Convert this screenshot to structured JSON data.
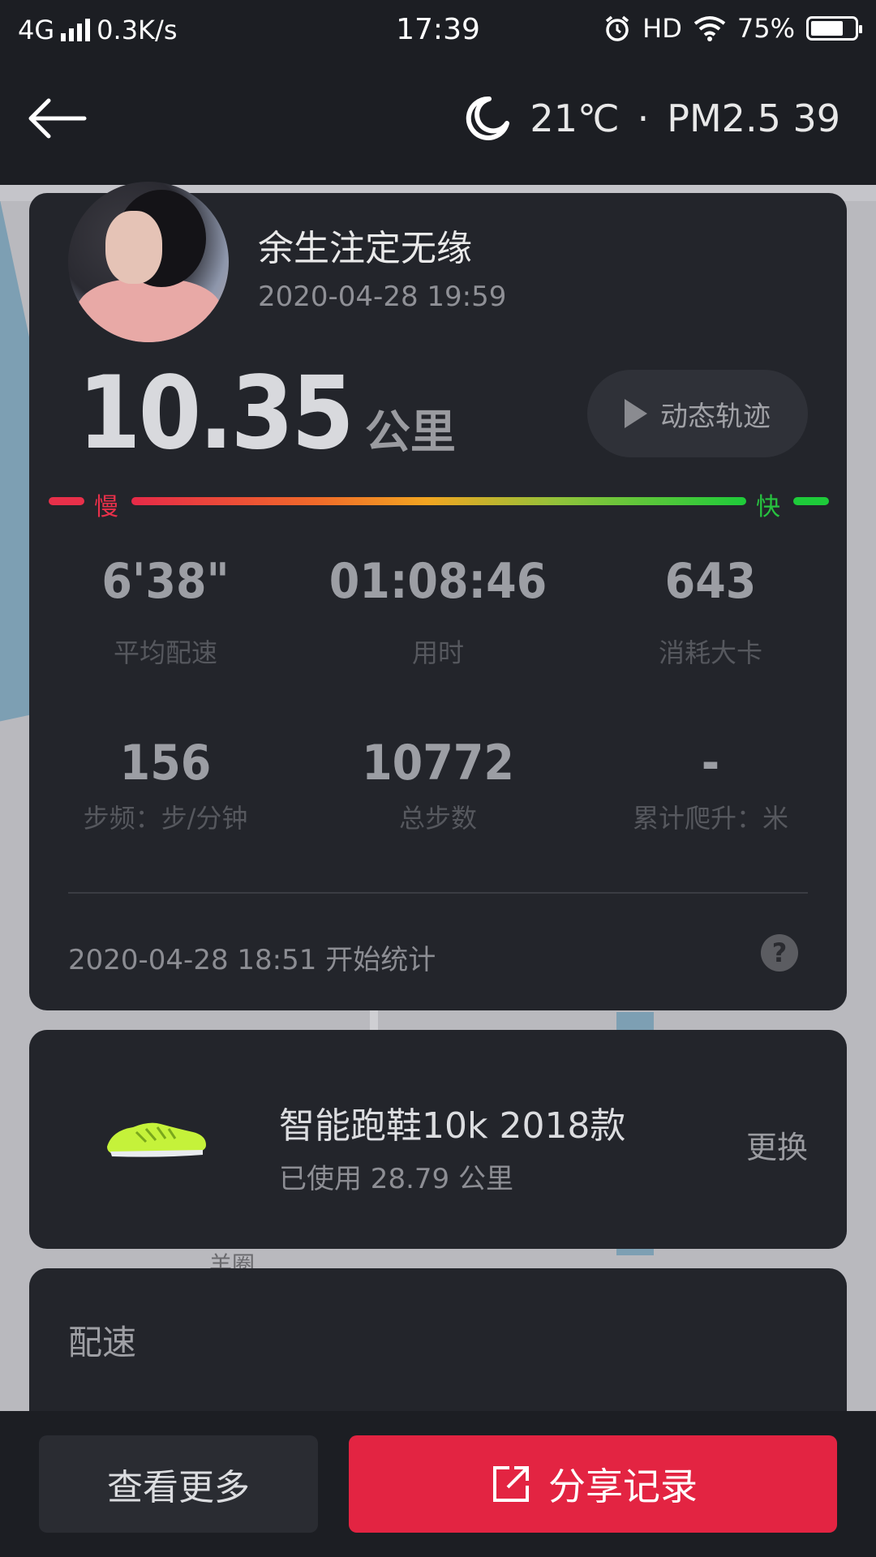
{
  "status_bar": {
    "network": "4G",
    "speed": "0.3K/s",
    "time": "17:39",
    "hd": "HD",
    "battery": "75%",
    "battery_level": 0.75
  },
  "header": {
    "temperature": "21℃",
    "separator": "·",
    "air_quality": "PM2.5 39"
  },
  "record": {
    "user_name": "余生注定无缘",
    "datetime": "2020-04-28 19:59",
    "distance": "10.35",
    "distance_unit": "公里",
    "track_button": "动态轨迹",
    "pace_slow_label": "慢",
    "pace_fast_label": "快",
    "stats_row1": [
      {
        "value": "6'38\"",
        "label": "平均配速"
      },
      {
        "value": "01:08:46",
        "label": "用时"
      },
      {
        "value": "643",
        "label": "消耗大卡"
      }
    ],
    "stats_row2": [
      {
        "value": "156",
        "label": "步频：步/分钟"
      },
      {
        "value": "10772",
        "label": "总步数"
      },
      {
        "value": "-",
        "label": "累计爬升：米"
      }
    ],
    "start_text": "2020-04-28 18:51  开始统计",
    "help_icon": "?"
  },
  "shoe": {
    "name": "智能跑鞋10k 2018款",
    "used": "已使用 28.79 公里",
    "change_label": "更换"
  },
  "map": {
    "label": "羊圈"
  },
  "pace_section": {
    "title": "配速"
  },
  "bottom": {
    "more_label": "查看更多",
    "share_label": "分享记录"
  },
  "colors": {
    "accent_red": "#e32442",
    "slow": "#e8304a",
    "fast": "#1ecb3a"
  }
}
